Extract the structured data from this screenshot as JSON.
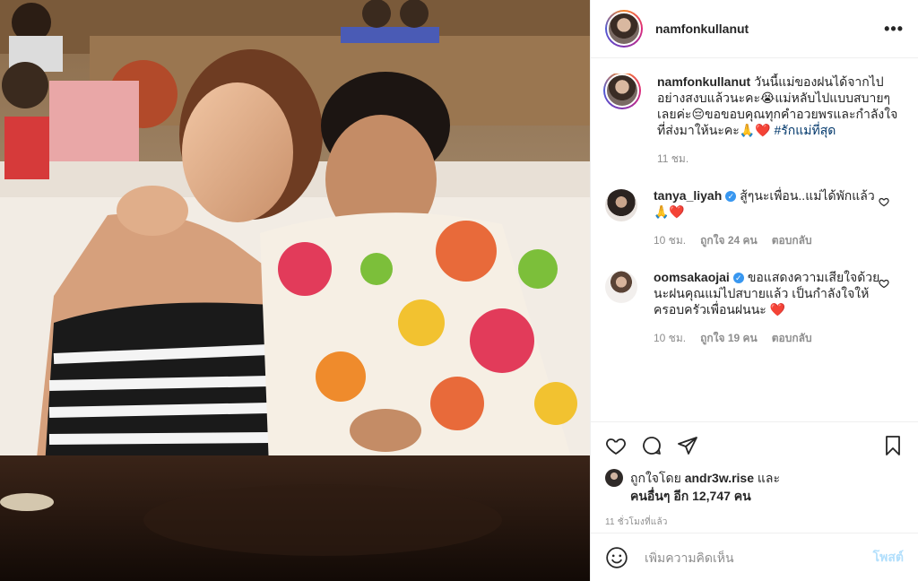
{
  "post": {
    "author": "namfonkullanut",
    "more_icon": "more-horizontal-icon"
  },
  "caption": {
    "username": "namfonkullanut",
    "text": "วันนี้แม่ของฝนได้จากไปอย่างสงบแล้วนะคะ😭แม่หลับไปแบบสบายๆเลยค่ะ😔ขอขอบคุณทุกคำอวยพรและกำลังใจที่ส่งมาให้นะคะ🙏❤️",
    "hashtag": "#รักแม่ที่สุด",
    "time": "11 ชม."
  },
  "comments": [
    {
      "username": "tanya_liyah",
      "verified": true,
      "text": "สู้ๆนะเพื่อน..แม่ได้พักแล้ว🙏❤️",
      "time": "10 ชม.",
      "likes": "ถูกใจ 24 คน",
      "reply": "ตอบกลับ"
    },
    {
      "username": "oomsakaojai",
      "verified": true,
      "text": "ขอแสดงความเสียใจด้วยนะฝนคุณแม่ไปสบายแล้ว เป็นกำลังใจให้ครอบครัวเพื่อนฝนนะ ❤️",
      "time": "10 ชม.",
      "likes": "ถูกใจ 19 คน",
      "reply": "ตอบกลับ"
    }
  ],
  "likes": {
    "prefix": "ถูกใจโดย",
    "user": "andr3w.rise",
    "and": "และ",
    "others": "คนอื่นๆ อีก 12,747 คน"
  },
  "posted_time": "11 ชั่วโมงที่แล้ว",
  "add_comment": {
    "placeholder": "เพิ่มความคิดเห็น",
    "post_label": "โพสต์"
  },
  "colors": {
    "link": "#00376b",
    "verified": "#3897f0",
    "post_disabled": "#b2dffc",
    "muted": "#8e8e8e"
  }
}
